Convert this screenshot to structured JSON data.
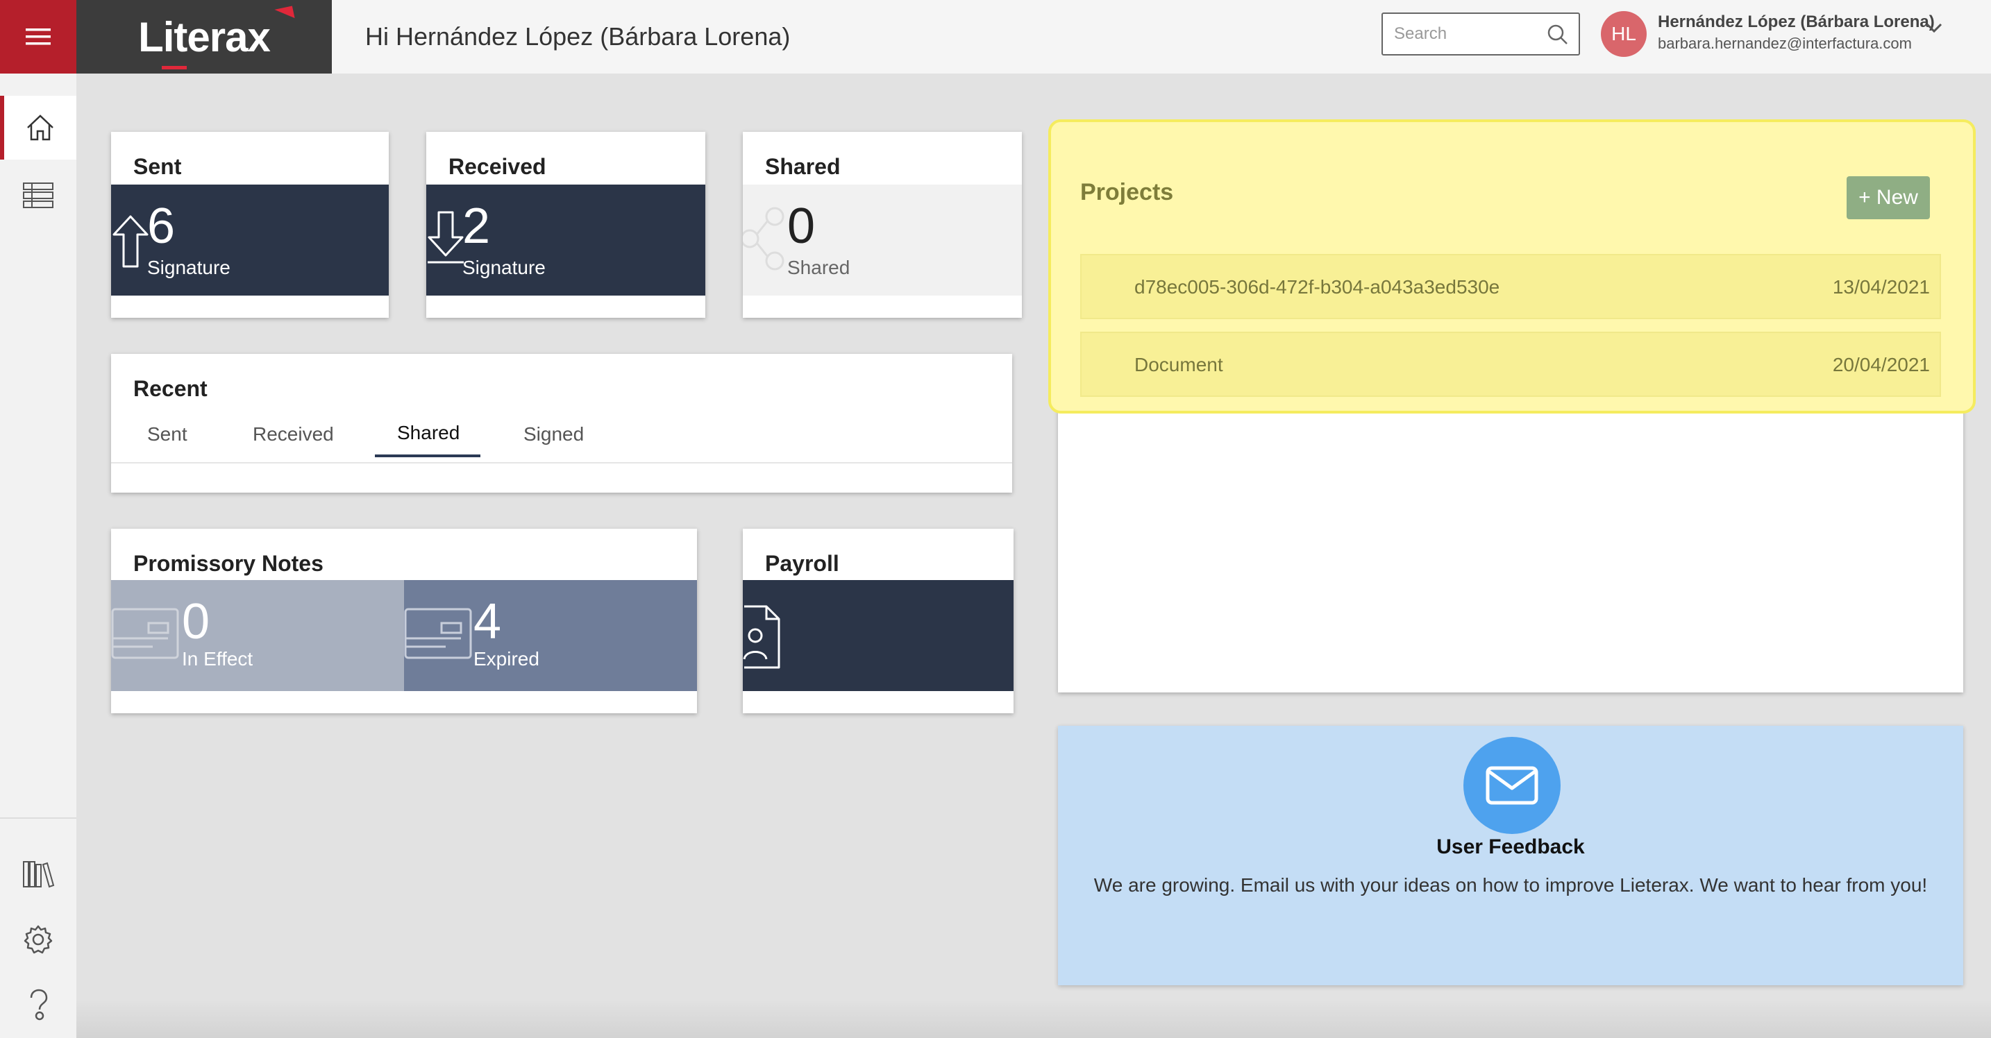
{
  "header": {
    "logo_text": "Literax",
    "greeting": "Hi Hernández López (Bárbara Lorena)",
    "search_placeholder": "Search",
    "user": {
      "initials": "HL",
      "name": "Hernández López (Bárbara Lorena)",
      "email": "barbara.hernandez@interfactura.com"
    }
  },
  "sidebar": {
    "items": [
      {
        "icon": "home-icon"
      },
      {
        "icon": "list-icon"
      },
      {
        "icon": "library-icon"
      },
      {
        "icon": "gear-icon"
      },
      {
        "icon": "help-icon"
      }
    ]
  },
  "cards": {
    "sent": {
      "title": "Sent",
      "count": "6",
      "label": "Signature"
    },
    "received": {
      "title": "Received",
      "count": "2",
      "label": "Signature"
    },
    "shared": {
      "title": "Shared",
      "count": "0",
      "label": "Shared"
    }
  },
  "recent": {
    "title": "Recent",
    "tabs": [
      "Sent",
      "Received",
      "Shared",
      "Signed"
    ],
    "active_tab": "Shared"
  },
  "promissory": {
    "title": "Promissory Notes",
    "in_effect": {
      "count": "0",
      "label": "In Effect"
    },
    "expired": {
      "count": "4",
      "label": "Expired"
    }
  },
  "payroll": {
    "title": "Payroll"
  },
  "projects": {
    "title": "Projects",
    "new_label": "+ New",
    "rows": [
      {
        "name": "d78ec005-306d-472f-b304-a043a3ed530e",
        "date": "13/04/2021"
      },
      {
        "name": "Document",
        "date": "20/04/2021"
      }
    ]
  },
  "feedback": {
    "title": "User Feedback",
    "text": "We are growing. Email us with your ideas on how to improve Lieterax. We want to hear from you!"
  },
  "colors": {
    "brand_red": "#b51f2b",
    "navy": "#2b3548",
    "slate": "#6f7d99",
    "slate_light": "#a8b0bf",
    "highlight": "#fff8ad",
    "feedback_bg": "#c4ddf5"
  }
}
